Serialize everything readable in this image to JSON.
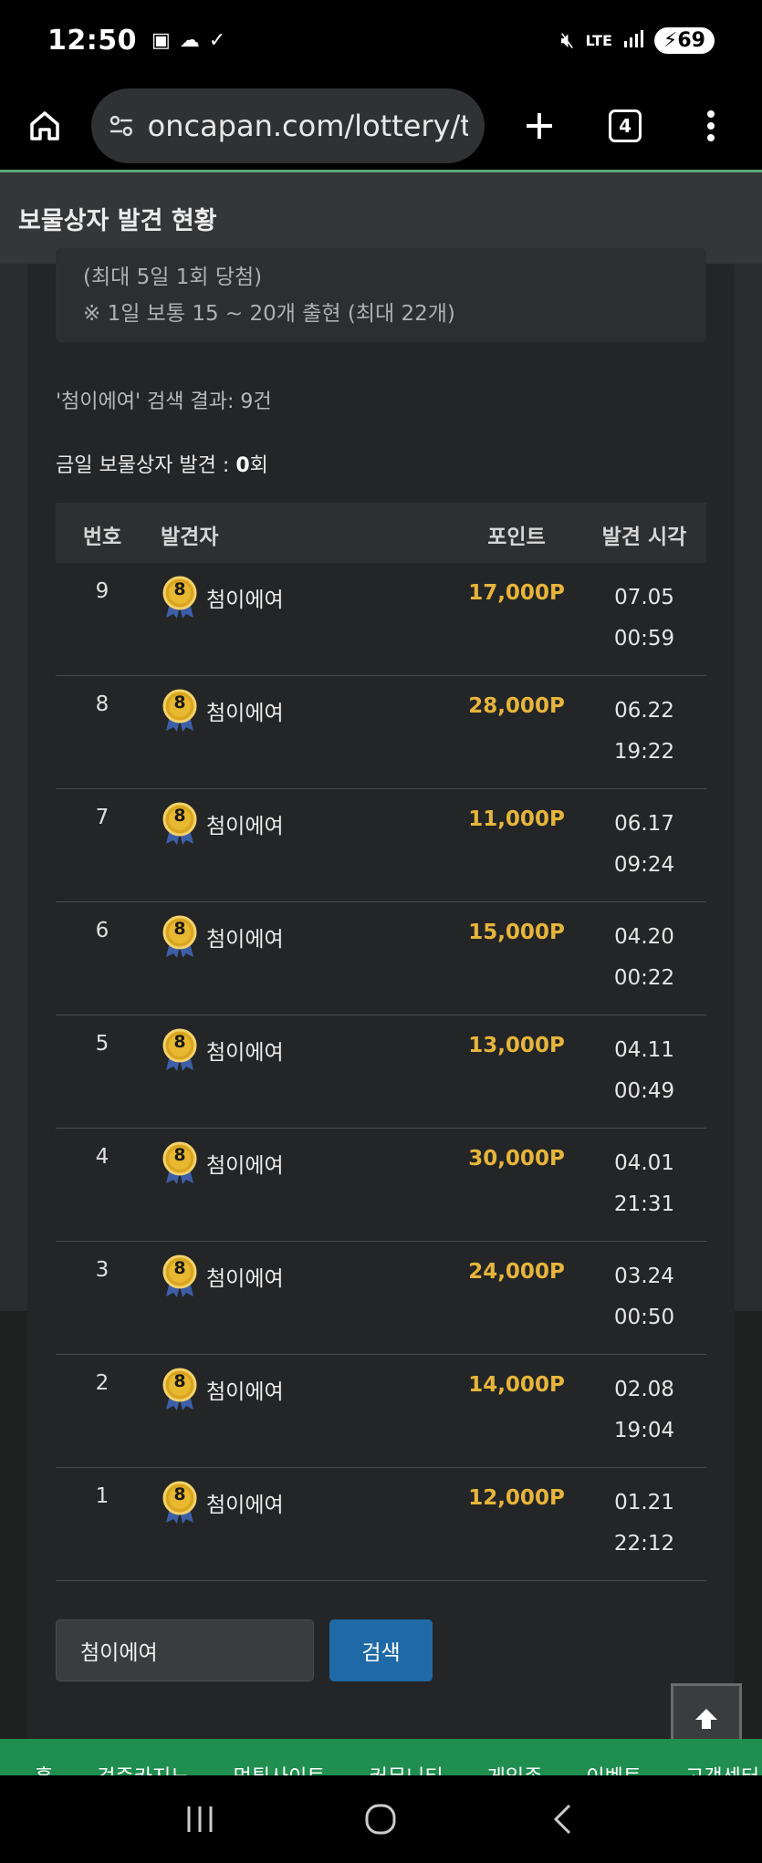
{
  "status_bar": {
    "time": "12:50",
    "network": "LTE",
    "battery": "69"
  },
  "browser": {
    "url": "oncapan.com/lottery/t",
    "tab_count": "4"
  },
  "page": {
    "title": "보물상자 발견 현황"
  },
  "notice": {
    "line1": "(최대 5일 1회 당첨)",
    "line2": "※ 1일 보통 15 ~ 20개 출현 (최대 22개)"
  },
  "search_result": "'첨이에여' 검색 결과: 9건",
  "today": {
    "label": "금일 보물상자 발견 :",
    "count": "0",
    "unit": "회"
  },
  "table": {
    "headers": {
      "no": "번호",
      "finder": "발견자",
      "point": "포인트",
      "time": "발견 시각"
    },
    "rows": [
      {
        "no": "9",
        "level": "8",
        "finder": "첨이에여",
        "point": "17,000P",
        "date": "07.05",
        "time": "00:59"
      },
      {
        "no": "8",
        "level": "8",
        "finder": "첨이에여",
        "point": "28,000P",
        "date": "06.22",
        "time": "19:22"
      },
      {
        "no": "7",
        "level": "8",
        "finder": "첨이에여",
        "point": "11,000P",
        "date": "06.17",
        "time": "09:24"
      },
      {
        "no": "6",
        "level": "8",
        "finder": "첨이에여",
        "point": "15,000P",
        "date": "04.20",
        "time": "00:22"
      },
      {
        "no": "5",
        "level": "8",
        "finder": "첨이에여",
        "point": "13,000P",
        "date": "04.11",
        "time": "00:49"
      },
      {
        "no": "4",
        "level": "8",
        "finder": "첨이에여",
        "point": "30,000P",
        "date": "04.01",
        "time": "21:31"
      },
      {
        "no": "3",
        "level": "8",
        "finder": "첨이에여",
        "point": "24,000P",
        "date": "03.24",
        "time": "00:50"
      },
      {
        "no": "2",
        "level": "8",
        "finder": "첨이에여",
        "point": "14,000P",
        "date": "02.08",
        "time": "19:04"
      },
      {
        "no": "1",
        "level": "8",
        "finder": "첨이에여",
        "point": "12,000P",
        "date": "01.21",
        "time": "22:12"
      }
    ]
  },
  "search": {
    "value": "첨이에여",
    "button_label": "검색"
  },
  "green_nav": [
    "홈",
    "검증카지노",
    "먹튀사이트",
    "커뮤니티",
    "게임존",
    "이벤트",
    "고객센터"
  ],
  "colors": {
    "accent_green": "#1f8e4f",
    "point_gold": "#e6b53c",
    "search_button": "#1f6aa6"
  }
}
